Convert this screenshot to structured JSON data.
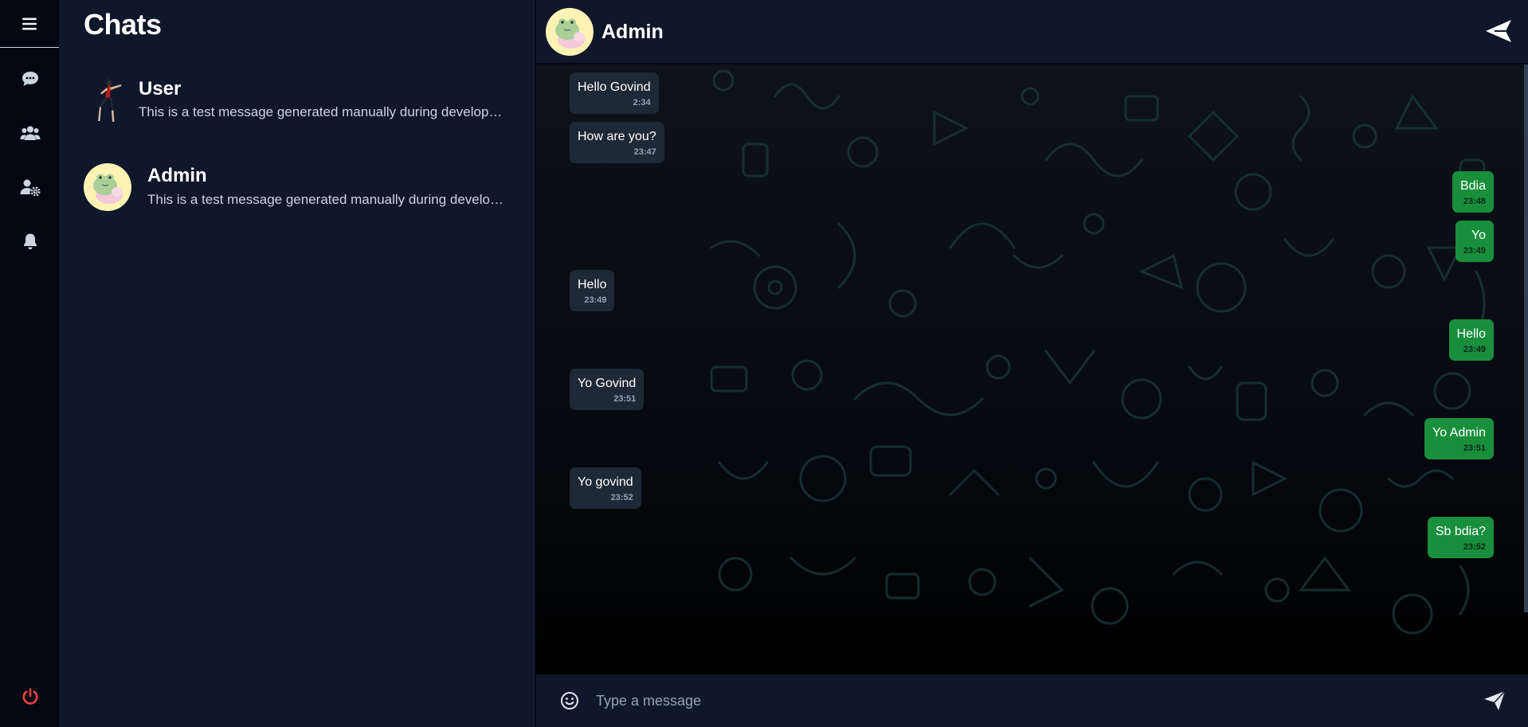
{
  "app": {
    "title": "Chats"
  },
  "rail": {
    "items": [
      {
        "icon": "hamburger-menu-icon"
      },
      {
        "icon": "chat-bubble-icon"
      },
      {
        "icon": "users-icon"
      },
      {
        "icon": "user-settings-icon"
      },
      {
        "icon": "bell-icon"
      }
    ],
    "logout_icon": "power-icon",
    "logout_color": "#ef4444"
  },
  "chat_list": [
    {
      "name": "User",
      "preview": "This is a test message generated manually during development and testing."
    },
    {
      "name": "Admin",
      "preview": "This is a test message generated manually during development and testing."
    }
  ],
  "conversation": {
    "name": "Admin",
    "back_icon": "paper-plane-left-icon",
    "messages": [
      {
        "direction": "in",
        "text": "Hello Govind",
        "time": "2:34"
      },
      {
        "direction": "in",
        "text": "How are you?",
        "time": "23:47"
      },
      {
        "direction": "out",
        "text": "Bdia",
        "time": "23:48"
      },
      {
        "direction": "out",
        "text": "Yo",
        "time": "23:49"
      },
      {
        "direction": "in",
        "text": "Hello",
        "time": "23:49"
      },
      {
        "direction": "out",
        "text": "Hello",
        "time": "23:49"
      },
      {
        "direction": "in",
        "text": "Yo Govind",
        "time": "23:51"
      },
      {
        "direction": "out",
        "text": "Yo Admin",
        "time": "23:51"
      },
      {
        "direction": "in",
        "text": "Yo govind",
        "time": "23:52"
      },
      {
        "direction": "out",
        "text": "Sb bdia?",
        "time": "23:52"
      }
    ]
  },
  "composer": {
    "placeholder": "Type a message",
    "value": "",
    "emoji_icon": "smiley-icon",
    "send_icon": "send-icon"
  },
  "colors": {
    "incoming_bubble": "#1e2937",
    "outgoing_bubble": "#198f3d",
    "panel_background": "#0f172a",
    "rail_background": "#030712"
  }
}
